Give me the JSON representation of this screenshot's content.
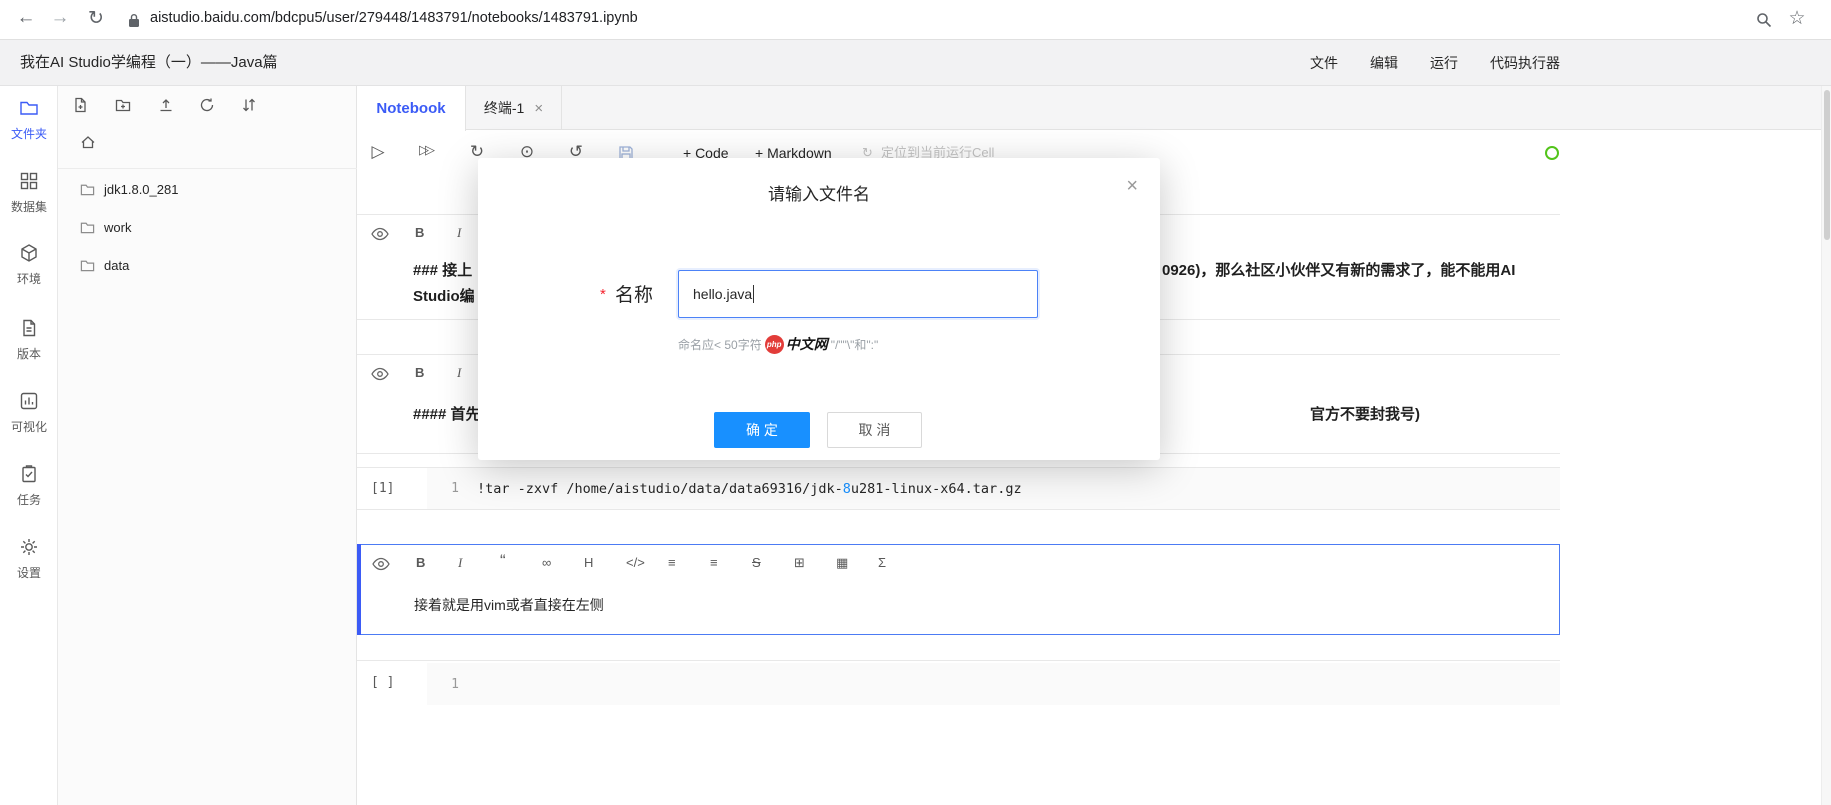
{
  "colors": {
    "accent": "#3b5bf6",
    "primary_button": "#1890ff",
    "kernel_idle": "#52c41a",
    "danger": "#f5222d"
  },
  "browser": {
    "url": "aistudio.baidu.com/bdcpu5/user/279448/1483791/notebooks/1483791.ipynb"
  },
  "header": {
    "title": "我在AI Studio学编程（一）——Java篇",
    "menu": [
      {
        "label": "文件"
      },
      {
        "label": "编辑"
      },
      {
        "label": "运行"
      },
      {
        "label": "代码执行器"
      }
    ]
  },
  "rail": {
    "items": [
      {
        "label": "文件夹"
      },
      {
        "label": "数据集"
      },
      {
        "label": "环境"
      },
      {
        "label": "版本"
      },
      {
        "label": "可视化"
      },
      {
        "label": "任务"
      },
      {
        "label": "设置"
      }
    ]
  },
  "files": {
    "folders": [
      {
        "name": "jdk1.8.0_281"
      },
      {
        "name": "work"
      },
      {
        "name": "data"
      }
    ]
  },
  "tabs": {
    "notebook": "Notebook",
    "terminal": "终端-1",
    "close": "×"
  },
  "nb_toolbar": {
    "add_code": "+ Code",
    "add_markdown": "+ Markdown",
    "locate": "定位到当前运行Cell"
  },
  "icons": {
    "back": "←",
    "forward": "→",
    "reload": "↻",
    "star": "☆",
    "play": "▷",
    "play_all": "▷▷",
    "restart": "↻",
    "interrupt": "⊙",
    "reset": "↺",
    "locate_refresh": "↻",
    "bold": "B",
    "italic": "I",
    "quote": "“",
    "link": "∞",
    "heading": "H",
    "code": "</>",
    "list_ul": "≡",
    "list_ol": "≡",
    "strike": "S",
    "table": "⊞",
    "image": "▦",
    "sigma": "Σ"
  },
  "cells": {
    "md1": {
      "line1_left": "### 接上",
      "line1_right": "0926)，那么社区小伙伴又有新的需求了，能不能用AI",
      "line2_left": "Studio编"
    },
    "md2": {
      "line1_left": "#### 首先",
      "line1_right": "官方不要封我号)"
    },
    "code1": {
      "exec": "[1]",
      "line_no": "1",
      "code_pre": "!tar -zxvf /home/aistudio/data/data69316/jdk-",
      "code_num": "8",
      "code_post": "u281-linux-x64.tar.gz"
    },
    "md3": {
      "text": "接着就是用vim或者直接在左侧"
    },
    "code2": {
      "exec": "[ ]",
      "line_no": "1"
    }
  },
  "modal": {
    "title": "请输入文件名",
    "close": "×",
    "required": "*",
    "name_label": "名称",
    "input_value": "hello.java",
    "hint_left": "命名应< 50字符",
    "hint_right": "\"/\"\"\\\"和\":\"",
    "wm_php": "php",
    "wm_cn": "中文网",
    "ok": "确 定",
    "cancel": "取 消"
  }
}
